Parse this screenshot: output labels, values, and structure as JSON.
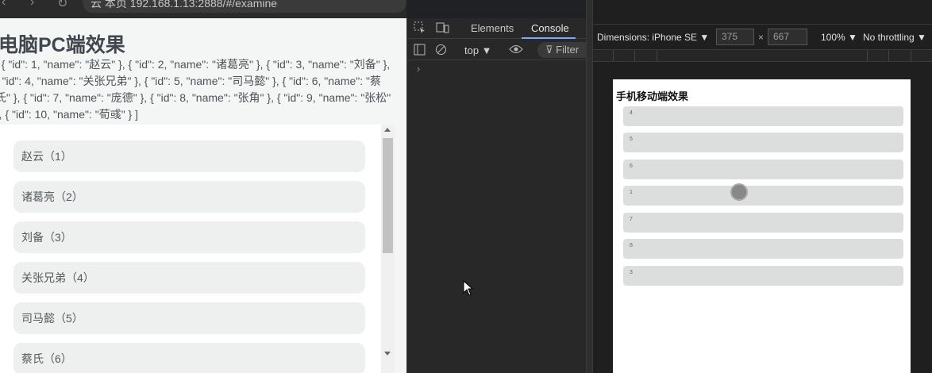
{
  "browser": {
    "address": "云 本页 192.168.1.13:2888/#/examine",
    "nav_back": "‹",
    "nav_forward": "›",
    "nav_reload": "↻"
  },
  "pc_page": {
    "title": "电脑PC端效果",
    "json_text": "[ { \"id\": 1, \"name\": \"赵云\" }, { \"id\": 2, \"name\": \"诸葛亮\" }, { \"id\": 3, \"name\": \"刘备\" }, { \"id\": 4, \"name\": \"关张兄弟\" }, { \"id\": 5, \"name\": \"司马懿\" }, { \"id\": 6, \"name\": \"蔡氏\" }, { \"id\": 7, \"name\": \"庞德\" }, { \"id\": 8, \"name\": \"张角\" }, { \"id\": 9, \"name\": \"张松\" }, { \"id\": 10, \"name\": \"荀彧\" } ]",
    "items": [
      "赵云（1）",
      "诸葛亮（2）",
      "刘备（3）",
      "关张兄弟（4）",
      "司马懿（5）",
      "蔡氏（6）"
    ]
  },
  "devtools": {
    "tab_elements": "Elements",
    "tab_console": "Console",
    "context": "top ▼",
    "filter": "Filter",
    "prompt": "›"
  },
  "device_toolbar": {
    "dimensions_label": "Dimensions: iPhone SE ▼",
    "width": "375",
    "times": "×",
    "height": "667",
    "zoom": "100% ▼",
    "throttling": "No throttling ▼"
  },
  "mobile": {
    "title": "手机移动端效果",
    "items": [
      "4",
      "5",
      "6",
      "1",
      "7",
      "8",
      "3"
    ]
  },
  "colors": {
    "accent_tab": "#7cacf8",
    "pc_item_bg": "#eef0ef",
    "mobile_item_bg": "#dcdedd"
  }
}
